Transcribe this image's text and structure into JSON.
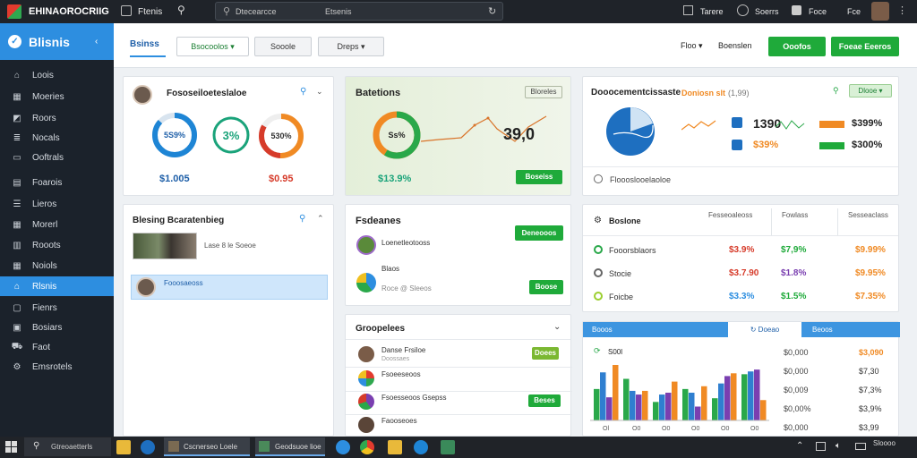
{
  "topbar": {
    "app_name": "EHINAOROCRIIG",
    "menu1": "Ftenis",
    "search_placeholder": "Dtecearcce",
    "search_tag": "Etsenis",
    "right1": "Tarere",
    "right2": "Soerrs",
    "right3": "Foce",
    "right4": "Fce"
  },
  "sidebar": {
    "brand": "Blisnis",
    "items": [
      {
        "label": "Loois",
        "icon": "home-icon"
      },
      {
        "label": "Moeries",
        "icon": "grid-icon"
      },
      {
        "label": "Roors",
        "icon": "chart-icon"
      },
      {
        "label": "Nocals",
        "icon": "stack-icon"
      },
      {
        "label": "Ooftrals",
        "icon": "folder-icon"
      },
      {
        "label": "Foarois",
        "icon": "document-icon"
      },
      {
        "label": "Lieros",
        "icon": "list-icon"
      },
      {
        "label": "Morerl",
        "icon": "calendar-icon"
      },
      {
        "label": "Rooots",
        "icon": "bars-icon"
      },
      {
        "label": "Noiols",
        "icon": "table-icon"
      },
      {
        "label": "Rlsnis",
        "icon": "home-icon"
      },
      {
        "label": "Fienrs",
        "icon": "file-icon"
      },
      {
        "label": "Bosiars",
        "icon": "box-icon"
      },
      {
        "label": "Faot",
        "icon": "cart-icon"
      },
      {
        "label": "Emsrotels",
        "icon": "gear-icon"
      }
    ]
  },
  "toolbar": {
    "tab_active": "Bsinss",
    "btn1": "Bsocoolos",
    "btn2": "Sooole",
    "btn3": "Dreps",
    "right_link1": "Floo",
    "right_link2": "Boenslen",
    "btn_green1": "Ooofos",
    "btn_green2": "Foeae Eeeros"
  },
  "card1": {
    "title": "Fososeiloeteslaloe",
    "gauge1_label": "5S9%",
    "gauge2_label": "3%",
    "gauge3_label": "530%",
    "value1": "$1.005",
    "value2": "$0.95"
  },
  "card2": {
    "title": "Batetions",
    "badge": "Bloreles",
    "gauge_label": "Ss%",
    "big_value": "39,0",
    "value": "$13.9%",
    "button": "Boseiss"
  },
  "card3": {
    "title": "Dooocementcissaste",
    "tag": "Doniosn slt",
    "tag2": "(1,99)",
    "btn": "Dlooe",
    "value1": "1390",
    "value2": "$39%",
    "bar1_value": "$399%",
    "bar2_value": "$300%",
    "footer": "Floooslooelaoloe"
  },
  "card4": {
    "title": "Blesing Bcaratenbieg",
    "row1_text": "Lase 8 le Soeoe",
    "row2_text": "Fooosaeoss"
  },
  "card5": {
    "title": "Fsdeanes",
    "btn_top": "Deneooos",
    "row1_name": "Loenetleotooss",
    "row2_name": "Blaos",
    "row2_sub": "Roce @ Sleeos",
    "btn_row2": "Boose"
  },
  "card6": {
    "title": "Groopelees",
    "rows": [
      {
        "name": "Danse Frsiloe",
        "sub": "Doossaes",
        "btn": "Doees"
      },
      {
        "name": "Fsoeeseoos",
        "sub": "",
        "btn": ""
      },
      {
        "name": "Fsoesseoos Gsepss",
        "sub": "",
        "btn": "Beses"
      },
      {
        "name": "Faooseoes",
        "sub": "",
        "btn": ""
      }
    ]
  },
  "card7": {
    "title": "Boslone",
    "columns": [
      "Fesseoaleoss",
      "Fowlass",
      "Sesseaclass"
    ],
    "rows": [
      {
        "name": "Fooorsblaors",
        "v1": "$3.9%",
        "v2": "$7,9%",
        "v3": "$9.99%"
      },
      {
        "name": "Stocie",
        "v1": "$3.7.90",
        "v2": "$1.8%",
        "v3": "$9.95%"
      },
      {
        "name": "Foicbe",
        "v1": "$3.3%",
        "v2": "$1.5%",
        "v3": "$7.35%"
      }
    ]
  },
  "card8": {
    "tab1": "Booos",
    "tab2": "Doeao",
    "tab3": "Beoos",
    "label": "S00l",
    "col1": [
      "$0,000",
      "$0,000",
      "$0,009",
      "$0,00%",
      "$0,000"
    ],
    "col2": [
      "$3,090",
      "$7,30",
      "$7,3%",
      "$3,9%",
      "$3,99"
    ],
    "x_ticks": [
      "Ol",
      "O0",
      "O0",
      "O0",
      "O0",
      "O0"
    ]
  },
  "chart_data": {
    "type": "bar",
    "categories": [
      "1",
      "2",
      "3",
      "4",
      "5",
      "6"
    ],
    "series": [
      {
        "values": [
          34,
          45,
          20,
          34,
          24,
          50
        ]
      },
      {
        "values": [
          52,
          32,
          28,
          30,
          40,
          53
        ]
      },
      {
        "values": [
          25,
          28,
          30,
          15,
          48,
          55
        ]
      },
      {
        "values": [
          60,
          32,
          42,
          37,
          51,
          22
        ]
      }
    ],
    "colors": [
      "#2aa84a",
      "#2f7fd0",
      "#7a3fb0",
      "#f08a24"
    ]
  },
  "taskbar": {
    "search": "Gtreoaetterls",
    "app1": "Cscnerseo Loele",
    "app2": "Geodsuoe lioe",
    "clock": "Sloooo"
  },
  "colors": {
    "accent": "#2d8ee0",
    "green": "#1faa3a",
    "orange": "#f08a24",
    "red": "#d63b2a",
    "purple": "#7a3fb0"
  }
}
